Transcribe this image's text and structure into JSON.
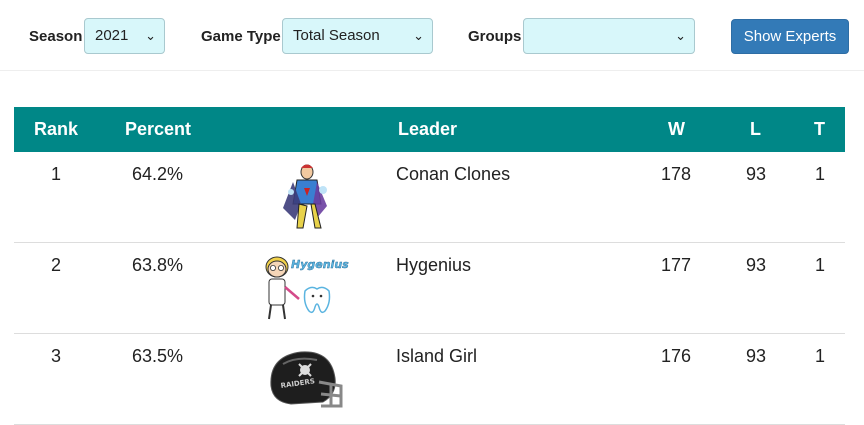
{
  "filters": {
    "season_label": "Season",
    "season_value": "2021",
    "game_type_label": "Game Type",
    "game_type_value": "Total Season",
    "groups_label": "Groups",
    "groups_value": "",
    "show_experts_label": "Show Experts"
  },
  "table": {
    "headers": {
      "rank": "Rank",
      "percent": "Percent",
      "leader": "Leader",
      "w": "W",
      "l": "L",
      "t": "T"
    },
    "rows": [
      {
        "rank": "1",
        "percent": "64.2%",
        "leader": "Conan Clones",
        "w": "178",
        "l": "93",
        "t": "1",
        "avatar": "superhero-avatar"
      },
      {
        "rank": "2",
        "percent": "63.8%",
        "leader": "Hygenius",
        "w": "177",
        "l": "93",
        "t": "1",
        "avatar": "dentist-tooth-avatar",
        "avatar_text": "Hygenius"
      },
      {
        "rank": "3",
        "percent": "63.5%",
        "leader": "Island Girl",
        "w": "176",
        "l": "93",
        "t": "1",
        "avatar": "football-helmet-avatar",
        "avatar_text": "RAIDERS"
      }
    ]
  },
  "colors": {
    "header_bg": "#008787",
    "select_bg": "#d8f7fa",
    "button_bg": "#337ab7"
  }
}
